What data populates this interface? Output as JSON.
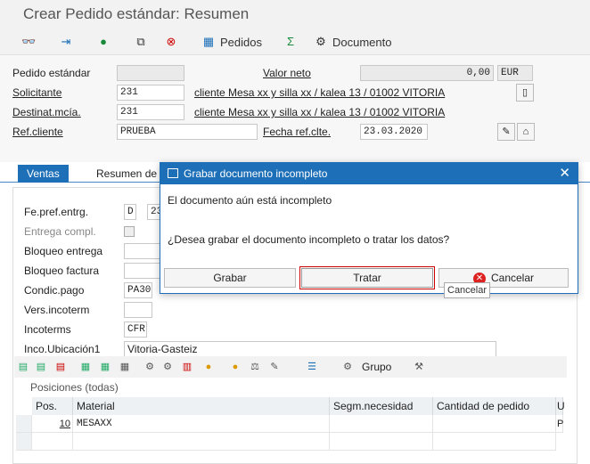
{
  "window": {
    "title": "Crear Pedido estándar: Resumen"
  },
  "toolbar": {
    "pedidos_label": "Pedidos",
    "documento_label": "Documento"
  },
  "header": {
    "pedido_label": "Pedido estándar",
    "valor_neto_label": "Valor neto",
    "valor_neto_value": "0,00",
    "currency": "EUR",
    "solicitante_label": "Solicitante",
    "solicitante_value": "231",
    "solicitante_desc": "cliente Mesa xx y silla xx / kalea 13 / 01002 VITORIA",
    "destinat_label": "Destinat.mcía.",
    "destinat_value": "231",
    "destinat_desc": "cliente Mesa xx y silla xx / kalea 13 / 01002 VITORIA",
    "refcliente_label": "Ref.cliente",
    "refcliente_value": "PRUEBA",
    "fecha_label": "Fecha ref.clte.",
    "fecha_value": "23.03.2020"
  },
  "tabs": [
    {
      "label": "Ventas"
    },
    {
      "label": "Resumen de"
    }
  ],
  "panel": {
    "fepref_label": "Fe.pref.entrg.",
    "fepref_value": "D",
    "fepref_date": "23",
    "entrega_label": "Entrega compl.",
    "bloqueo_entrega_label": "Bloqueo entrega",
    "bloqueo_factura_label": "Bloqueo factura",
    "condic_label": "Condic.pago",
    "condic_value": "PA30",
    "vers_label": "Vers.incoterm",
    "incoterms_label": "Incoterms",
    "incoterms_value": "CFR",
    "inco_ubic_label": "Inco.Ubicación1",
    "inco_ubic_value": "Vitoria-Gasteiz",
    "grupo_label": "Grupo",
    "posiciones_label": "Posiciones (todas)"
  },
  "table": {
    "headers": [
      "Pos.",
      "Material",
      "Segm.necesidad",
      "Cantidad de pedido",
      "U"
    ],
    "rows": [
      {
        "pos": "10",
        "material": "MESAXX",
        "u": "P"
      }
    ]
  },
  "dialog": {
    "title": "Grabar documento incompleto",
    "line1": "El documento aún está incompleto",
    "line2": "¿Desea grabar el documento incompleto o tratar los datos?",
    "grabar_label": "Grabar",
    "tratar_label": "Tratar",
    "cancelar_label": "Cancelar",
    "tooltip": "Cancelar"
  }
}
